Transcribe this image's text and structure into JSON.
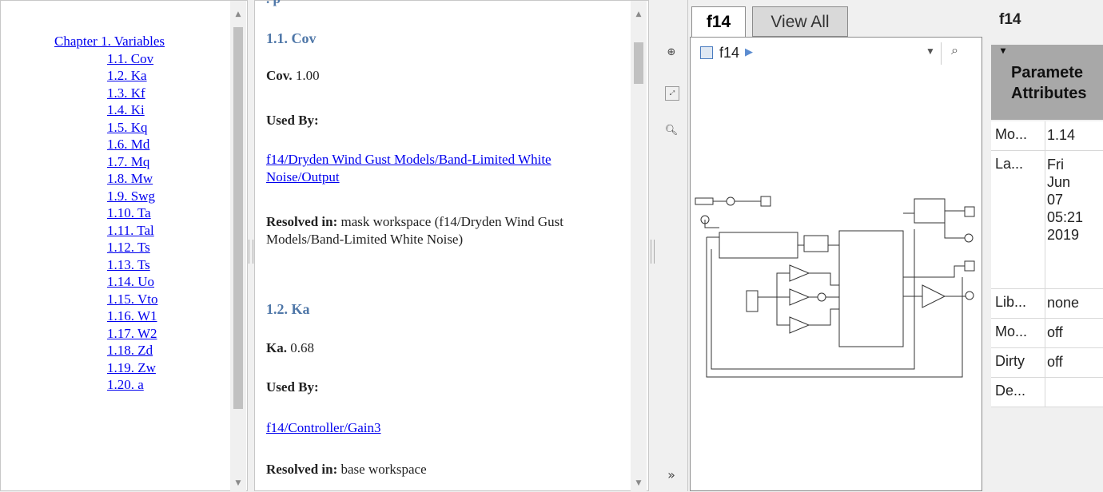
{
  "toc": {
    "items": [
      {
        "label": "Chapter 1. Variables",
        "level": "chap"
      },
      {
        "label": "1.1. Cov",
        "level": "sec"
      },
      {
        "label": "1.2. Ka",
        "level": "sec"
      },
      {
        "label": "1.3. Kf",
        "level": "sec"
      },
      {
        "label": "1.4. Ki",
        "level": "sec"
      },
      {
        "label": "1.5. Kq",
        "level": "sec"
      },
      {
        "label": "1.6. Md",
        "level": "sec"
      },
      {
        "label": "1.7. Mq",
        "level": "sec"
      },
      {
        "label": "1.8. Mw",
        "level": "sec"
      },
      {
        "label": "1.9. Swg",
        "level": "sec"
      },
      {
        "label": "1.10. Ta",
        "level": "sec"
      },
      {
        "label": "1.11. Tal",
        "level": "sec"
      },
      {
        "label": "1.12. Ts",
        "level": "sec"
      },
      {
        "label": "1.13. Ts",
        "level": "sec"
      },
      {
        "label": "1.14. Uo",
        "level": "sec"
      },
      {
        "label": "1.15. Vto",
        "level": "sec"
      },
      {
        "label": "1.16. W1",
        "level": "sec"
      },
      {
        "label": "1.17. W2",
        "level": "sec"
      },
      {
        "label": "1.18. Zd",
        "level": "sec"
      },
      {
        "label": "1.19. Zw",
        "level": "sec"
      },
      {
        "label": "1.20. a",
        "level": "sec"
      }
    ]
  },
  "content": {
    "s1": {
      "heading": "1.1. Cov",
      "name": "Cov.",
      "value": "1.00",
      "used_by_label": "Used By:",
      "used_by_link": "f14/Dryden Wind Gust Models/Band-Limited White Noise/Output",
      "resolved_label": "Resolved in:",
      "resolved_text": "mask workspace (f14/Dryden Wind Gust Models/Band-Limited White Noise)"
    },
    "s2": {
      "heading": "1.2. Ka",
      "name": "Ka.",
      "value": "0.68",
      "used_by_label": "Used By:",
      "used_by_link": "f14/Controller/Gain3",
      "resolved_label": "Resolved in:",
      "resolved_text": "base workspace"
    }
  },
  "sim": {
    "tabs": [
      "f14",
      "View All"
    ],
    "breadcrumb": "f14",
    "toolbar": {
      "collapse_icon": "double-chevron-right-icon"
    }
  },
  "inspector": {
    "title": "f14",
    "header_lines": [
      "Paramete",
      "Attributes"
    ],
    "rows": [
      {
        "key": "Mo...",
        "value": "1.14"
      },
      {
        "key": "La...",
        "value": "Fri Jun 07 05:21  2019"
      },
      {
        "key": "Lib...",
        "value": "none"
      },
      {
        "key": "Mo...",
        "value": "off"
      },
      {
        "key": "Dirty",
        "value": "off"
      },
      {
        "key": "De...",
        "value": ""
      }
    ]
  }
}
